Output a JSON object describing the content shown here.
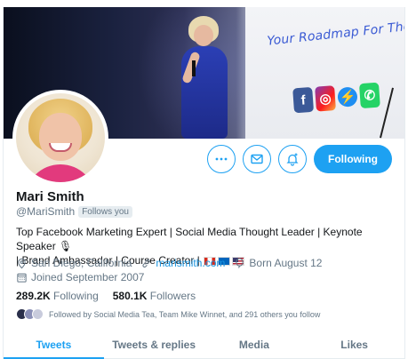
{
  "banner": {
    "screen_text": "Your Roadmap For The Futur",
    "social_icons": [
      "facebook-icon",
      "instagram-icon",
      "messenger-icon",
      "whatsapp-icon"
    ]
  },
  "profile": {
    "name": "Mari Smith",
    "handle": "@MariSmith",
    "follows_you": "Follows you",
    "bio_line1": "Top Facebook Marketing Expert | Social Media Thought Leader | Keynote Speaker 🎙",
    "bio_line2": "| Brand Ambassador | Course Creator |",
    "location": "San Diego, California",
    "website": "marismith.com",
    "born": "Born August 12",
    "joined": "Joined September 2007",
    "following_count": "289.2K",
    "following_label": "Following",
    "followers_count": "580.1K",
    "followers_label": "Followers",
    "followed_by": "Followed by Social Media Tea, Team Mike Winnet, and 291 others you follow"
  },
  "actions": {
    "more_icon": "more-icon",
    "message_icon": "envelope-icon",
    "notify_icon": "bell-plus-icon",
    "follow_label": "Following"
  },
  "tabs": [
    {
      "label": "Tweets",
      "active": true
    },
    {
      "label": "Tweets & replies",
      "active": false
    },
    {
      "label": "Media",
      "active": false
    },
    {
      "label": "Likes",
      "active": false
    }
  ],
  "colors": {
    "accent": "#1da1f2",
    "secondary_text": "#657786",
    "primary_text": "#14171a"
  }
}
